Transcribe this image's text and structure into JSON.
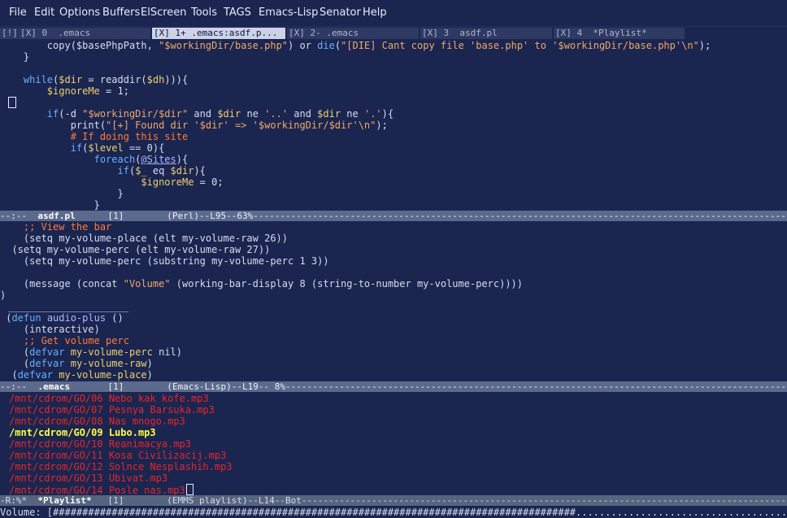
{
  "menu": [
    "File",
    "Edit",
    "Options",
    "Buffers",
    "ElScreen",
    "Tools",
    "TAGS",
    "Emacs-Lisp",
    "Senator",
    "Help"
  ],
  "tabs": [
    {
      "label": "[!]"
    },
    {
      "label": "[X] 0  .emacs"
    },
    {
      "label": "[X] 1+ .emacs:asdf.p..."
    },
    {
      "label": "[X] 2- .emacs"
    },
    {
      "label": "[X] 3  asdf.pl"
    },
    {
      "label": "[X] 4  *Playlist*"
    }
  ],
  "perl": {
    "lines": [
      [
        [
          "",
          "        copy($basePhpPath, "
        ],
        [
          "str",
          "\"$workingDir/base.php\""
        ],
        [
          "",
          ") or "
        ],
        [
          "kw",
          "die"
        ],
        [
          "",
          "("
        ],
        [
          "str",
          "\"[DIE] Cant copy file 'base.php' to '$workingDir/base.php'\\n\""
        ],
        [
          "",
          ");"
        ]
      ],
      [
        [
          "",
          "    }"
        ]
      ],
      [
        [
          "",
          ""
        ]
      ],
      [
        [
          "",
          "    "
        ],
        [
          "kw",
          "while"
        ],
        [
          "",
          "("
        ],
        [
          "var",
          "$dir"
        ],
        [
          "",
          " = readdir("
        ],
        [
          "var",
          "$dh"
        ],
        [
          "",
          "))){"
        ]
      ],
      [
        [
          "",
          "        "
        ],
        [
          "var",
          "$ignoreMe"
        ],
        [
          "",
          " = 1;"
        ]
      ],
      [
        [
          "",
          ""
        ]
      ],
      [
        [
          "",
          "        "
        ],
        [
          "kw",
          "if"
        ],
        [
          "",
          "(-d "
        ],
        [
          "str",
          "\"$workingDir/$dir\""
        ],
        [
          "",
          " and "
        ],
        [
          "var",
          "$dir"
        ],
        [
          "",
          " ne "
        ],
        [
          "str",
          "'..'"
        ],
        [
          "",
          " and "
        ],
        [
          "var",
          "$dir"
        ],
        [
          "",
          " ne "
        ],
        [
          "str",
          "'.'"
        ],
        [
          "",
          "){"
        ]
      ],
      [
        [
          "",
          "            print("
        ],
        [
          "str",
          "\"[+] Found dir '$dir' => '$workingDir/$dir'\\n\""
        ],
        [
          "",
          ");"
        ]
      ],
      [
        [
          "",
          "            "
        ],
        [
          "com",
          "# If doing this site"
        ]
      ],
      [
        [
          "",
          "            "
        ],
        [
          "kw",
          "if"
        ],
        [
          "",
          "("
        ],
        [
          "var",
          "$level"
        ],
        [
          "",
          " == 0){"
        ]
      ],
      [
        [
          "",
          "                "
        ],
        [
          "kw",
          "foreach"
        ],
        [
          "",
          "("
        ],
        [
          "fnul",
          "@Sites"
        ],
        [
          "",
          "){"
        ]
      ],
      [
        [
          "",
          "                    "
        ],
        [
          "kw",
          "if"
        ],
        [
          "",
          "("
        ],
        [
          "var",
          "$_"
        ],
        [
          "",
          " eq "
        ],
        [
          "var",
          "$dir"
        ],
        [
          "",
          "){"
        ]
      ],
      [
        [
          "",
          "                        "
        ],
        [
          "var",
          "$ignoreMe"
        ],
        [
          "",
          " = 0;"
        ]
      ],
      [
        [
          "",
          "                    }"
        ]
      ],
      [
        [
          "",
          "                }"
        ]
      ]
    ],
    "modeline": {
      "prefix": "--:--  ",
      "name": "asdf.pl",
      "rest": "      [1]        (Perl)--L95--63%-------------------------------------------------------------------------------------------------------------"
    }
  },
  "elisp": {
    "lines": [
      [
        [
          "",
          "    "
        ],
        [
          "com",
          ";; View the bar"
        ]
      ],
      [
        [
          "",
          "    (setq my-volume-place (elt my-volume-raw 26))"
        ]
      ],
      [
        [
          "",
          "  (setq my-volume-perc (elt my-volume-raw 27))"
        ]
      ],
      [
        [
          "",
          "    (setq my-volume-perc (substring my-volume-perc 1 3))"
        ]
      ],
      [
        [
          "",
          ""
        ]
      ],
      [
        [
          "",
          "    (message (concat "
        ],
        [
          "str",
          "\"Volume\""
        ],
        [
          "",
          " (working-bar-display 8 (string-to-number my-volume-perc))))"
        ]
      ],
      [
        [
          "",
          ")"
        ]
      ],
      [
        [
          "",
          ""
        ]
      ],
      [
        [
          "",
          " ("
        ],
        [
          "kw",
          "defun"
        ],
        [
          "",
          " "
        ],
        [
          "fn",
          "audio-plus"
        ],
        [
          "",
          " ()"
        ]
      ],
      [
        [
          "",
          "    (interactive)"
        ]
      ],
      [
        [
          "",
          "    "
        ],
        [
          "com",
          ";; Get volume perc"
        ]
      ],
      [
        [
          "",
          "    ("
        ],
        [
          "kw",
          "defvar"
        ],
        [
          "",
          " "
        ],
        [
          "var",
          "my-volume-perc"
        ],
        [
          "",
          " nil)"
        ]
      ],
      [
        [
          "",
          "    ("
        ],
        [
          "kw",
          "defvar"
        ],
        [
          "",
          " "
        ],
        [
          "var",
          "my-volume-raw"
        ],
        [
          "",
          ")"
        ]
      ],
      [
        [
          "",
          "  ("
        ],
        [
          "kw",
          "defvar"
        ],
        [
          "",
          " "
        ],
        [
          "var",
          "my-volume-place"
        ],
        [
          "",
          ")"
        ]
      ]
    ],
    "modeline": {
      "prefix": "--:--  ",
      "name": ".emacs",
      "rest": "       [1]        (Emacs-Lisp)--L19-- 8%-------------------------------------------------------------------------------------------------------------"
    }
  },
  "playlist": {
    "tracks": [
      "/mnt/cdrom/GO/06 Nebo kak kofe.mp3",
      "/mnt/cdrom/GO/07 Pesnya Barsuka.mp3",
      "/mnt/cdrom/GO/08 Nas mnogo.mp3",
      "/mnt/cdrom/GO/09 Lubo.mp3",
      "/mnt/cdrom/GO/10 Reanimacya.mp3",
      "/mnt/cdrom/GO/11 Kosa Civilizacij.mp3",
      "/mnt/cdrom/GO/12 Solnce Nesplashih.mp3",
      "/mnt/cdrom/GO/13 Ubivat.mp3",
      "/mnt/cdrom/GO/14 Posle nas.mp3"
    ],
    "current_index": 3,
    "modeline": {
      "prefix": "-R:%*  ",
      "name": "*Playlist*",
      "rest": "   [1]        (EMMS playlist)--L14--Bot-------------------------------------------------------------------------------------------------------------"
    }
  },
  "minibuffer": "Volume: [#########################################################################################........................................]",
  "volume_percent": 66
}
